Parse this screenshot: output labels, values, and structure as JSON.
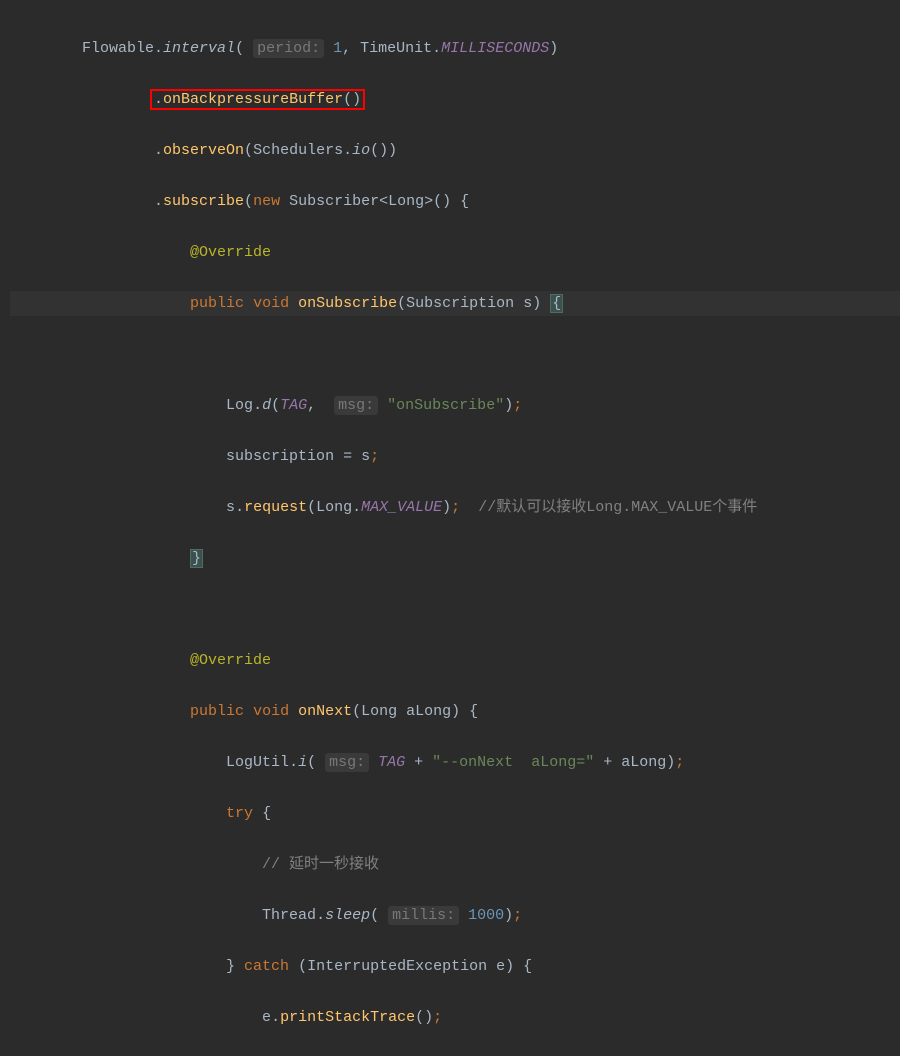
{
  "colors": {
    "background": "#2b2b2b",
    "text": "#a9b7c6",
    "keyword": "#cc7832",
    "method": "#ffc66d",
    "string": "#6a8759",
    "annotation": "#bbb529",
    "comment": "#808080",
    "constant": "#9876aa",
    "number": "#6897bb",
    "highlight_border": "#ff0000"
  },
  "code": {
    "line1": {
      "class": "Flowable",
      "method": "interval",
      "param_hint": "period:",
      "value": "1",
      "sep": ",",
      "unit_class": "TimeUnit",
      "unit_const": "MILLISECONDS"
    },
    "line2": {
      "method": "onBackpressureBuffer"
    },
    "line3": {
      "method": "observeOn",
      "arg_class": "Schedulers",
      "arg_method": "io"
    },
    "line4": {
      "method": "subscribe",
      "new_kw": "new",
      "type": "Subscriber",
      "generic": "Long"
    },
    "line5": {
      "annotation": "@Override"
    },
    "line6": {
      "modifier": "public",
      "return": "void",
      "name": "onSubscribe",
      "param_type": "Subscription",
      "param_name": "s"
    },
    "line8": {
      "class": "Log",
      "method": "d",
      "arg1": "TAG",
      "hint": "msg:",
      "string": "\"onSubscribe\""
    },
    "line9": {
      "lhs": "subscription",
      "rhs": "s"
    },
    "line10": {
      "obj": "s",
      "method": "request",
      "arg_class": "Long",
      "arg_const": "MAX_VALUE",
      "comment": "//默认可以接收Long.MAX_VALUE个事件"
    },
    "line13": {
      "annotation": "@Override"
    },
    "line14": {
      "modifier": "public",
      "return": "void",
      "name": "onNext",
      "param_type": "Long",
      "param_name": "aLong"
    },
    "line15": {
      "class": "LogUtil",
      "method": "i",
      "hint": "msg:",
      "arg1": "TAG",
      "str1": "\"--onNext  aLong=\"",
      "arg2": "aLong"
    },
    "line16": {
      "kw": "try"
    },
    "line17": {
      "comment": "// 延时一秒接收"
    },
    "line18": {
      "class": "Thread",
      "method": "sleep",
      "hint": "millis:",
      "value": "1000"
    },
    "line19": {
      "kw": "catch",
      "type": "InterruptedException",
      "var": "e"
    },
    "line20": {
      "obj": "e",
      "method": "printStackTrace"
    }
  }
}
